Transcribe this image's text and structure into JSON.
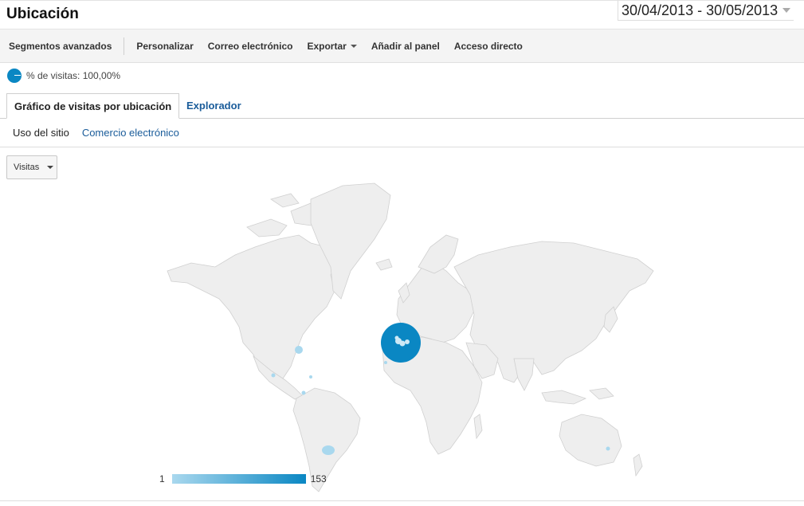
{
  "header": {
    "title": "Ubicación",
    "date_range": "30/04/2013 - 30/05/2013"
  },
  "toolbar": {
    "items": [
      "Segmentos avanzados",
      "Personalizar",
      "Correo electrónico",
      "Exportar",
      "Añadir al panel",
      "Acceso directo"
    ]
  },
  "segment": {
    "label": "% de visitas: 100,00%"
  },
  "tabs": {
    "active": "Gráfico de visitas por ubicación",
    "other": "Explorador"
  },
  "subtabs": {
    "items": [
      "Uso del sitio",
      "Comercio electrónico"
    ]
  },
  "metric_select": {
    "value": "Visitas"
  },
  "legend": {
    "min": "1",
    "max": "153",
    "color_low": "#a9d8ee",
    "color_high": "#0a87c3"
  },
  "colors": {
    "accent": "#0a87c3",
    "link": "#1a5c9a",
    "land": "#eeeeee"
  }
}
